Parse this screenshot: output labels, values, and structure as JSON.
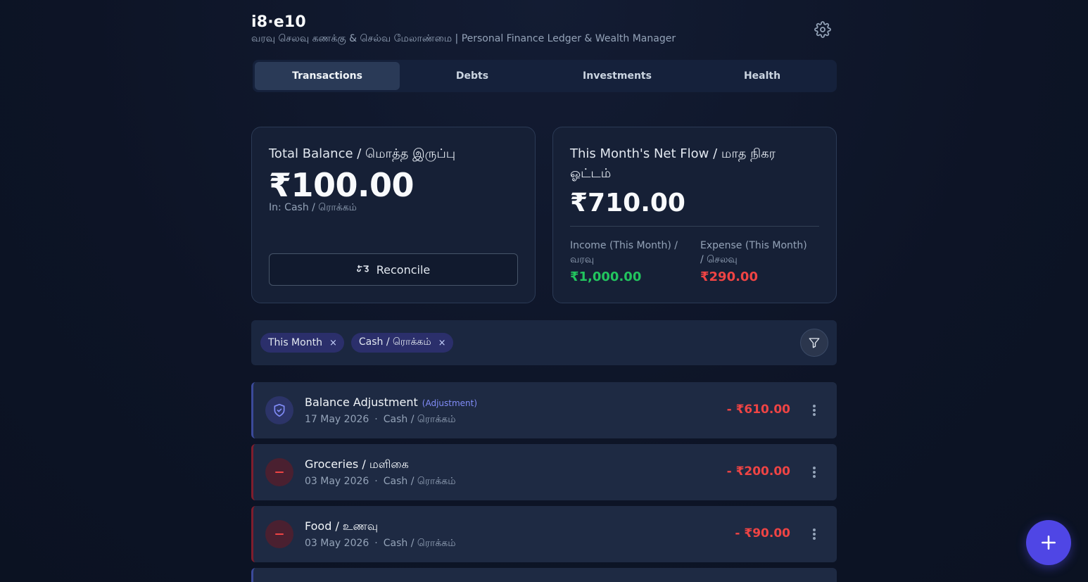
{
  "header": {
    "title": "i8·e10",
    "subtitle": "வரவு செலவு கணக்கு & செல்வ மேலாண்மை | Personal Finance Ledger & Wealth Manager"
  },
  "tabs": [
    {
      "label": "Transactions",
      "active": true
    },
    {
      "label": "Debts",
      "active": false
    },
    {
      "label": "Investments",
      "active": false
    },
    {
      "label": "Health",
      "active": false
    }
  ],
  "balance_card": {
    "label": "Total Balance / மொத்த இருப்பு",
    "amount": "₹100.00",
    "sub": "In: Cash / ரொக்கம்",
    "reconcile_label": "Reconcile"
  },
  "netflow_card": {
    "label": "This Month's Net Flow / மாத நிகர ஓட்டம்",
    "amount": "₹710.00",
    "income_label": "Income (This Month) / வரவு",
    "income_value": "₹1,000.00",
    "expense_label": "Expense (This Month) / செலவு",
    "expense_value": "₹290.00",
    "income_color": "#22c55e",
    "expense_color": "#ef4444"
  },
  "filters": {
    "chips": [
      {
        "label": "This Month",
        "close": "×"
      },
      {
        "label": "Cash / ரொக்கம்",
        "close": "×"
      }
    ]
  },
  "transactions": [
    {
      "title": "Balance Adjustment",
      "tag": "(Adjustment)",
      "date": "17 May 2026",
      "sep": "·",
      "account": "Cash / ரொக்கம்",
      "amount": "- ₹610.00",
      "icon": "shield-check-icon"
    },
    {
      "title": "Groceries / மளிகை",
      "tag": "",
      "date": "03 May 2026",
      "sep": "·",
      "account": "Cash / ரொக்கம்",
      "amount": "- ₹200.00",
      "icon": "minus-icon"
    },
    {
      "title": "Food / உணவு",
      "tag": "",
      "date": "03 May 2026",
      "sep": "·",
      "account": "Cash / ரொக்கம்",
      "amount": "- ₹90.00",
      "icon": "minus-icon"
    }
  ],
  "colors": {
    "accent": "#4f46e5",
    "background": "#0f172a",
    "negative": "#ef4444",
    "positive": "#22c55e"
  }
}
